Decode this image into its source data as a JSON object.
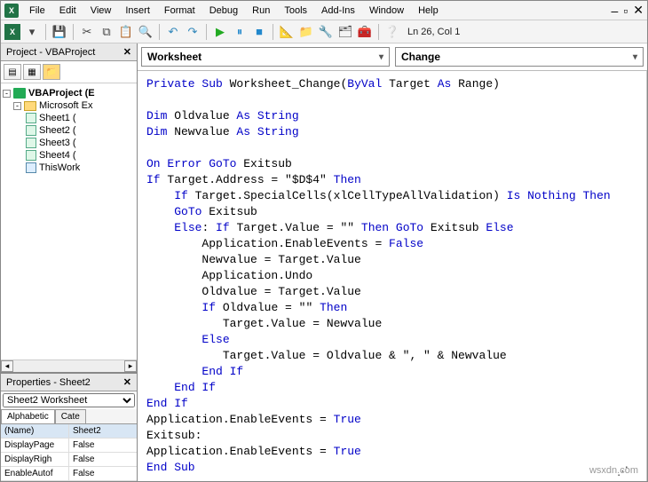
{
  "menu": {
    "items": [
      "File",
      "Edit",
      "View",
      "Insert",
      "Format",
      "Debug",
      "Run",
      "Tools",
      "Add-Ins",
      "Window",
      "Help"
    ]
  },
  "status": "Ln 26, Col 1",
  "project": {
    "title": "Project - VBAProject",
    "root": "VBAProject (E",
    "folder": "Microsoft Ex",
    "items": [
      "Sheet1 (",
      "Sheet2 (",
      "Sheet3 (",
      "Sheet4 ("
    ],
    "wb": "ThisWork"
  },
  "properties": {
    "title": "Properties - Sheet2",
    "selector": "Sheet2 Worksheet",
    "tabs": [
      "Alphabetic",
      "Cate"
    ],
    "rows": [
      {
        "k": "(Name)",
        "v": "Sheet2",
        "sel": true
      },
      {
        "k": "DisplayPage",
        "v": "False"
      },
      {
        "k": "DisplayRigh",
        "v": "False"
      },
      {
        "k": "EnableAutof",
        "v": "False"
      }
    ]
  },
  "dropdowns": {
    "object": "Worksheet",
    "proc": "Change"
  },
  "code_lines": [
    [
      [
        "kw",
        "Private Sub"
      ],
      [
        "",
        " Worksheet_Change("
      ],
      [
        "kw",
        "ByVal"
      ],
      [
        "",
        " Target "
      ],
      [
        "kw",
        "As"
      ],
      [
        "",
        " Range)"
      ]
    ],
    [
      [
        "",
        ""
      ]
    ],
    [
      [
        "kw",
        "Dim"
      ],
      [
        "",
        " Oldvalue "
      ],
      [
        "kw",
        "As String"
      ]
    ],
    [
      [
        "kw",
        "Dim"
      ],
      [
        "",
        " Newvalue "
      ],
      [
        "kw",
        "As String"
      ]
    ],
    [
      [
        "",
        ""
      ]
    ],
    [
      [
        "kw",
        "On Error GoTo"
      ],
      [
        "",
        " Exitsub"
      ]
    ],
    [
      [
        "kw",
        "If"
      ],
      [
        "",
        " Target.Address = \"$D$4\" "
      ],
      [
        "kw",
        "Then"
      ]
    ],
    [
      [
        "",
        "    "
      ],
      [
        "kw",
        "If"
      ],
      [
        "",
        " Target.SpecialCells(xlCellTypeAllValidation) "
      ],
      [
        "kw",
        "Is Nothing Then"
      ]
    ],
    [
      [
        "",
        "    "
      ],
      [
        "kw",
        "GoTo"
      ],
      [
        "",
        " Exitsub"
      ]
    ],
    [
      [
        "",
        "    "
      ],
      [
        "kw",
        "Else"
      ],
      [
        "",
        ": "
      ],
      [
        "kw",
        "If"
      ],
      [
        "",
        " Target.Value = \"\" "
      ],
      [
        "kw",
        "Then GoTo"
      ],
      [
        "",
        " Exitsub "
      ],
      [
        "kw",
        "Else"
      ]
    ],
    [
      [
        "",
        "        Application.EnableEvents = "
      ],
      [
        "kw",
        "False"
      ]
    ],
    [
      [
        "",
        "        Newvalue = Target.Value"
      ]
    ],
    [
      [
        "",
        "        Application.Undo"
      ]
    ],
    [
      [
        "",
        "        Oldvalue = Target.Value"
      ]
    ],
    [
      [
        "",
        "        "
      ],
      [
        "kw",
        "If"
      ],
      [
        "",
        " Oldvalue = \"\" "
      ],
      [
        "kw",
        "Then"
      ]
    ],
    [
      [
        "",
        "           Target.Value = Newvalue"
      ]
    ],
    [
      [
        "",
        "        "
      ],
      [
        "kw",
        "Else"
      ]
    ],
    [
      [
        "",
        "           Target.Value = Oldvalue & \", \" & Newvalue"
      ]
    ],
    [
      [
        "",
        "        "
      ],
      [
        "kw",
        "End If"
      ]
    ],
    [
      [
        "",
        "    "
      ],
      [
        "kw",
        "End If"
      ]
    ],
    [
      [
        "kw",
        "End If"
      ]
    ],
    [
      [
        "",
        "Application.EnableEvents = "
      ],
      [
        "kw",
        "True"
      ]
    ],
    [
      [
        "",
        "Exitsub:"
      ]
    ],
    [
      [
        "",
        "Application.EnableEvents = "
      ],
      [
        "kw",
        "True"
      ]
    ],
    [
      [
        "kw",
        "End Sub"
      ]
    ]
  ],
  "watermark": "wsxdn.com"
}
